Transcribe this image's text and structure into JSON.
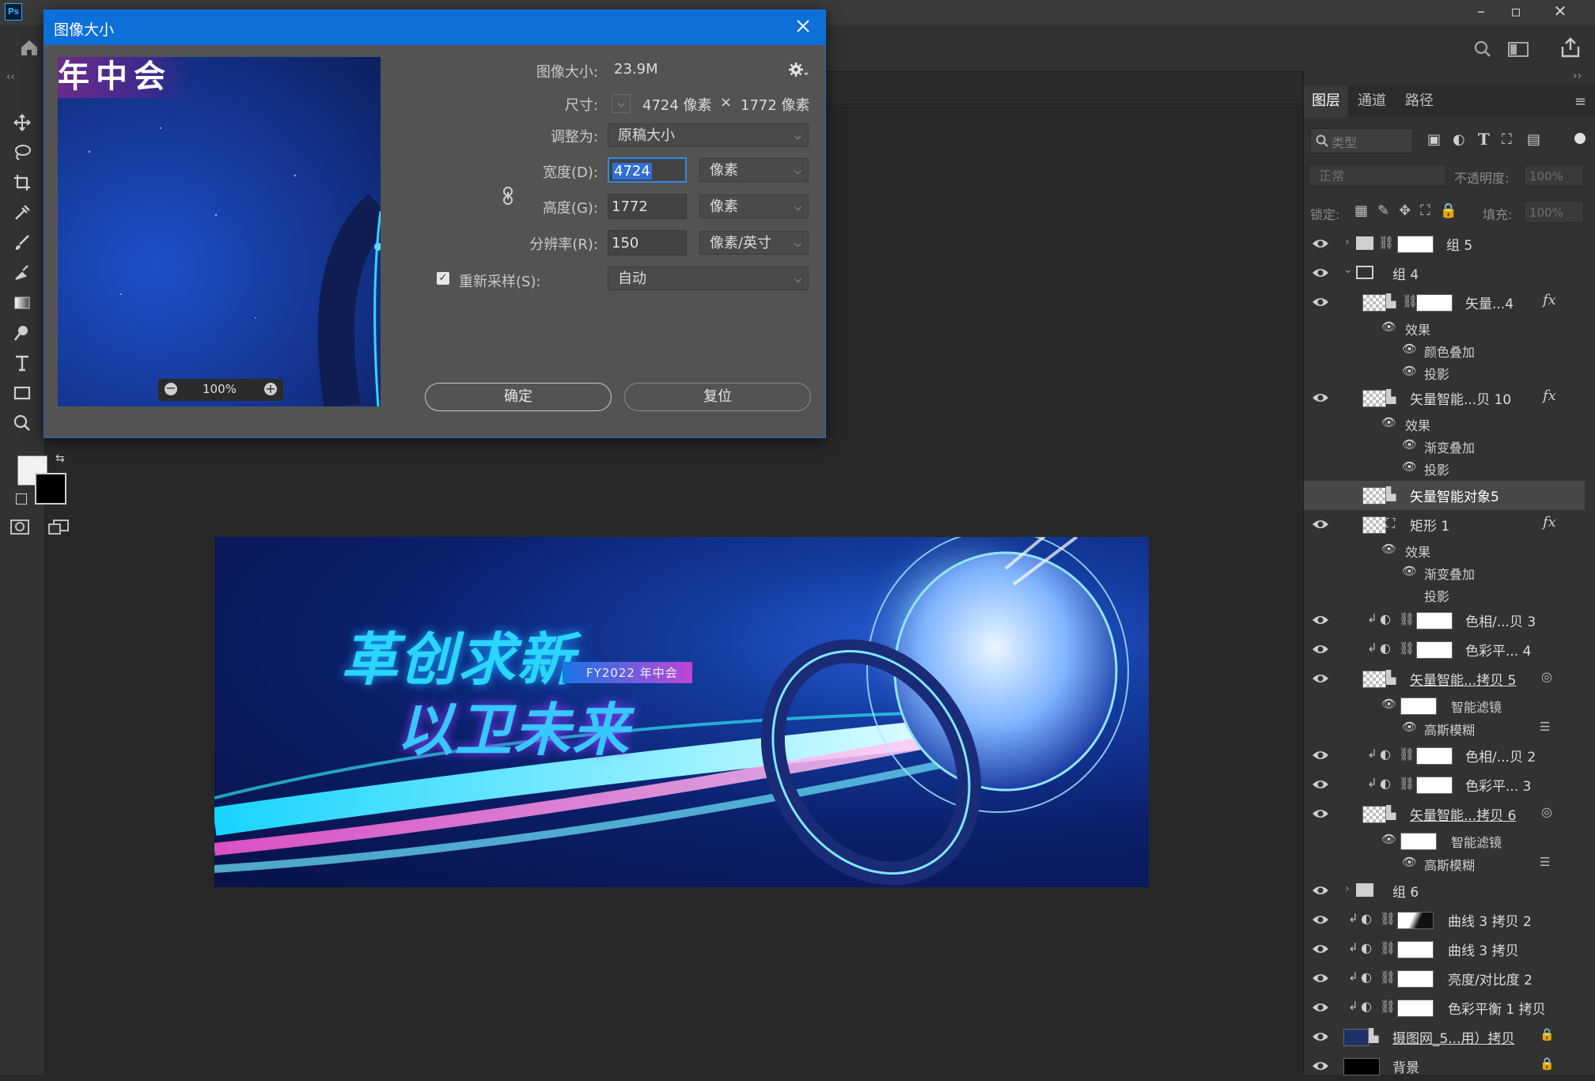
{
  "app": {
    "logo": "Ps"
  },
  "dialog": {
    "title": "图像大小",
    "image_size_label": "图像大小:",
    "image_size_value": "23.9M",
    "dimensions_label": "尺寸:",
    "dim_width": "4724 像素",
    "dim_times": "×",
    "dim_height": "1772 像素",
    "fit_to_label": "调整为:",
    "fit_to_value": "原稿大小",
    "width_label": "宽度(D):",
    "width_value": "4724",
    "width_unit": "像素",
    "height_label": "高度(G):",
    "height_value": "1772",
    "height_unit": "像素",
    "resolution_label": "分辨率(R):",
    "resolution_value": "150",
    "resolution_unit": "像素/英寸",
    "resample_label": "重新采样(S):",
    "resample_value": "自动",
    "resample_checked": true,
    "ok_label": "确定",
    "reset_label": "复位",
    "preview_zoom": "100%",
    "preview_text": "年中会"
  },
  "banner": {
    "line1": "革创求新",
    "line2": "以卫未来",
    "tag": "FY2022 年中会"
  },
  "panel": {
    "tabs": [
      "图层",
      "通道",
      "路径"
    ],
    "search_placeholder": "类型",
    "blend_mode": "正常",
    "opacity_label": "不透明度:",
    "opacity_value": "100%",
    "lock_label": "锁定:",
    "fill_label": "填充:",
    "fill_value": "100%",
    "layers": [
      {
        "name": "组 5"
      },
      {
        "name": "组 4"
      },
      {
        "name": "矢量...4",
        "fx": "fx"
      },
      {
        "name": "效果"
      },
      {
        "name": "颜色叠加"
      },
      {
        "name": "投影"
      },
      {
        "name": "矢量智能...贝 10",
        "fx": "fx"
      },
      {
        "name": "效果"
      },
      {
        "name": "渐变叠加"
      },
      {
        "name": "投影"
      },
      {
        "name": "矢量智能对象5"
      },
      {
        "name": "矩形 1",
        "fx": "fx"
      },
      {
        "name": "效果"
      },
      {
        "name": "渐变叠加"
      },
      {
        "name": "投影"
      },
      {
        "name": "色相/...贝 3"
      },
      {
        "name": "色彩平... 4"
      },
      {
        "name": "矢量智能...拷贝 5"
      },
      {
        "name": "智能滤镜"
      },
      {
        "name": "高斯模糊"
      },
      {
        "name": "色相/...贝 2"
      },
      {
        "name": "色彩平... 3"
      },
      {
        "name": "矢量智能...拷贝 6"
      },
      {
        "name": "智能滤镜"
      },
      {
        "name": "高斯模糊"
      },
      {
        "name": "组 6"
      },
      {
        "name": "曲线 3 拷贝 2"
      },
      {
        "name": "曲线 3 拷贝"
      },
      {
        "name": "亮度/对比度 2"
      },
      {
        "name": "色彩平衡 1 拷贝"
      },
      {
        "name": "摄图网_5...用）拷贝"
      },
      {
        "name": "背景"
      }
    ]
  }
}
